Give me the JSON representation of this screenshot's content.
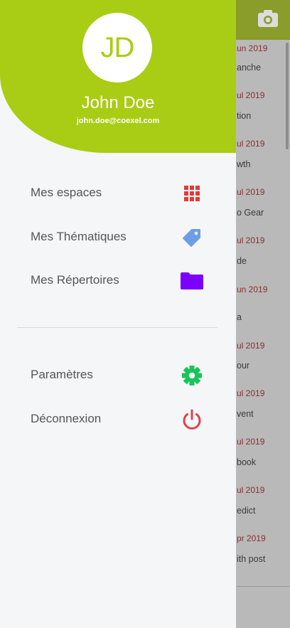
{
  "background_list": {
    "rows": [
      {
        "date": "un 2019",
        "title": "anche"
      },
      {
        "date": "ul 2019",
        "title": "tion"
      },
      {
        "date": "ul 2019",
        "title": "wth"
      },
      {
        "date": "ul 2019",
        "title": "o Gear"
      },
      {
        "date": "ul 2019",
        "title": "de"
      },
      {
        "date": "un 2019",
        "title": "a"
      },
      {
        "date": "ul 2019",
        "title": "our"
      },
      {
        "date": "ul 2019",
        "title": "vent"
      },
      {
        "date": "ul 2019",
        "title": "book"
      },
      {
        "date": "ul 2019",
        "title": "edict"
      },
      {
        "date": "pr 2019",
        "title": "ith post"
      }
    ]
  },
  "drawer": {
    "avatar_initials": "JD",
    "user_name": "John Doe",
    "user_email": "john.doe@coexel.com",
    "menu": [
      {
        "label": "Mes espaces",
        "icon": "grid-icon",
        "color": "#e53935"
      },
      {
        "label": "Mes Thématiques",
        "icon": "tag-icon",
        "color": "#6e9ee6"
      },
      {
        "label": "Mes Répertoires",
        "icon": "folder-icon",
        "color": "#7b00ff"
      }
    ],
    "secondary_menu": [
      {
        "label": "Paramètres",
        "icon": "gear-icon",
        "color": "#18c45a"
      },
      {
        "label": "Déconnexion",
        "icon": "power-icon",
        "color": "#e0434b"
      }
    ]
  },
  "colors": {
    "accent": "#a9cc14",
    "drawer_background": "#f5f6f8"
  }
}
